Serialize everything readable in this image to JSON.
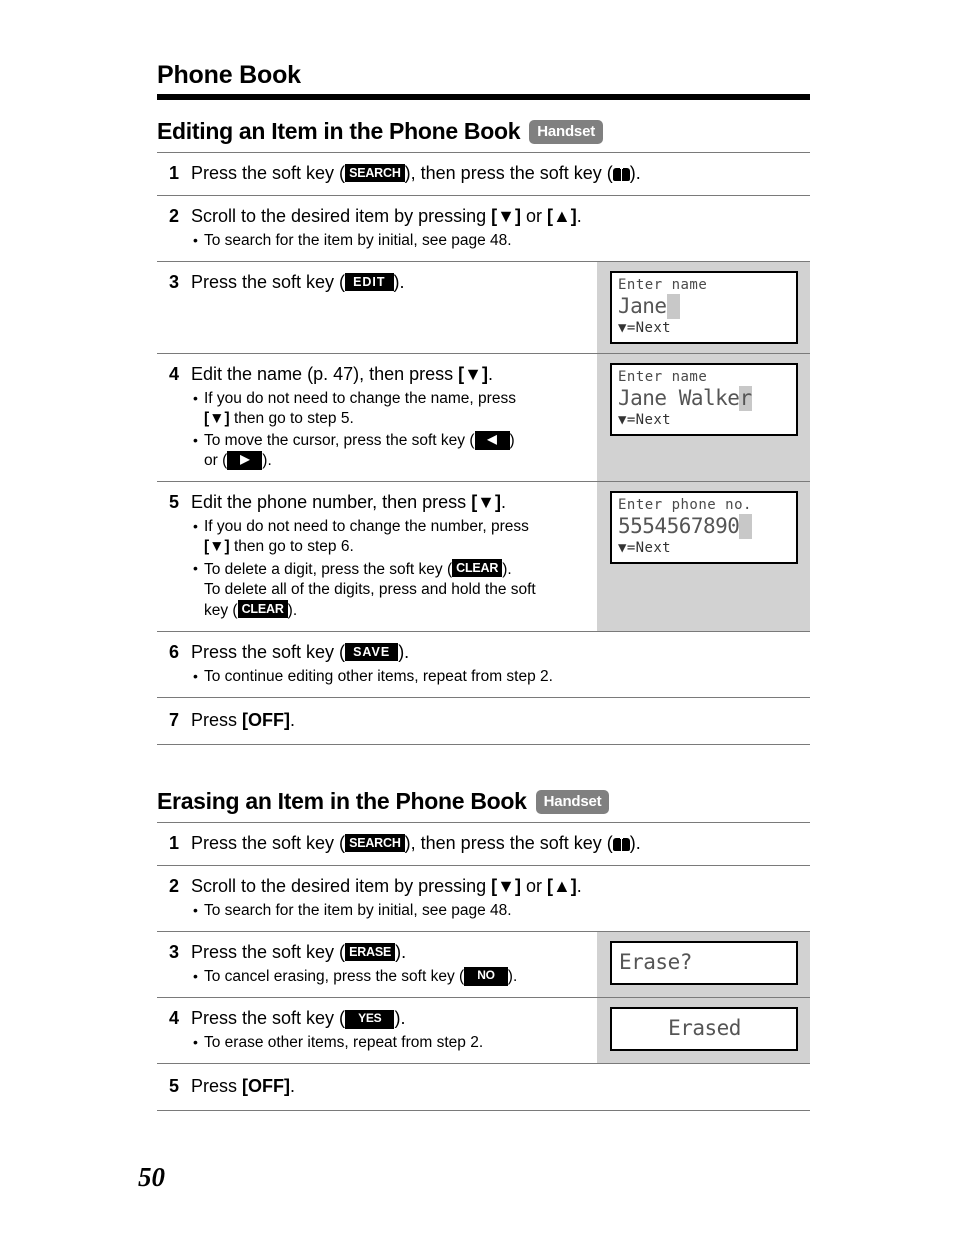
{
  "page": {
    "running_head": "Phone Book",
    "folio": "50"
  },
  "sections": [
    {
      "title": "Editing an Item in the Phone Book",
      "badge": "Handset",
      "steps": [
        {
          "num": "1",
          "text_parts": [
            "Press the soft key (",
            "SEARCH",
            "), then press the soft key (",
            "book-icon",
            ")."
          ],
          "key": "SEARCH",
          "text_a": "Press the soft key (",
          "text_b": "), then press the soft key (",
          "text_c": ").",
          "bullets": []
        },
        {
          "num": "2",
          "text_a": "Scroll to the desired item by pressing ",
          "key_a": "[▼]",
          "text_b": " or ",
          "key_b": "[▲]",
          "text_c": ".",
          "bullets": [
            "To search for the item by initial, see page 48."
          ]
        },
        {
          "num": "3",
          "text_a": "Press the soft key (",
          "key": "EDIT",
          "text_b": ").",
          "bullets": [],
          "lcd": {
            "title": "Enter name",
            "entry": "Jane",
            "cursor": "block",
            "foot": "▼=Next"
          }
        },
        {
          "num": "4",
          "text_a": "Edit the name (p. 47), then press ",
          "key_a": "[▼]",
          "text_b": ".",
          "bullets": [],
          "bullet_rich": [
            "If you do not need to change the name, press [▼] then go to step 5.",
            "To move the cursor, press the soft key ( ◀ ) or ( ▶ )."
          ],
          "lcd": {
            "title": "Enter name",
            "entry": "Jane Walke",
            "cursor_char": "r",
            "foot": "▼=Next"
          }
        },
        {
          "num": "5",
          "text_a": "Edit the phone number, then press ",
          "key_a": "[▼]",
          "text_b": ".",
          "bullet_rich": [
            "If you do not need to change the number, press [▼] then go to step 6.",
            "To delete a digit, press the soft key ( CLEAR ). To delete all of the digits, press and hold the soft key ( CLEAR )."
          ],
          "lcd": {
            "title": "Enter phone no.",
            "entry": "5554567890",
            "cursor": "block",
            "foot": "▼=Next"
          }
        },
        {
          "num": "6",
          "text_a": "Press the soft key (",
          "key": "SAVE",
          "text_b": ").",
          "bullets": [
            "To continue editing other items, repeat from step 2."
          ]
        },
        {
          "num": "7",
          "text_a": "Press ",
          "key_a": "[OFF]",
          "text_b": ".",
          "bullets": []
        }
      ]
    },
    {
      "title": "Erasing an Item in the Phone Book",
      "badge": "Handset",
      "steps": [
        {
          "num": "1",
          "text_a": "Press the soft key (",
          "key": "SEARCH",
          "text_b": "), then press the soft key (",
          "text_c": ").",
          "bullets": []
        },
        {
          "num": "2",
          "text_a": "Scroll to the desired item by pressing ",
          "key_a": "[▼]",
          "text_b": " or ",
          "key_b": "[▲]",
          "text_c": ".",
          "bullets": [
            "To search for the item by initial, see page 48."
          ]
        },
        {
          "num": "3",
          "text_a": "Press the soft key (",
          "key": "ERASE",
          "text_b": ").",
          "bullet_rich": [
            "To cancel erasing, press the soft key ( NO )."
          ],
          "lcd": {
            "entry": "Erase?",
            "align": "left"
          }
        },
        {
          "num": "4",
          "text_a": "Press the soft key (",
          "key": "YES",
          "text_b": ").",
          "bullets": [
            "To erase other items, repeat from step 2."
          ],
          "lcd": {
            "entry": "Erased",
            "align": "center"
          }
        },
        {
          "num": "5",
          "text_a": "Press ",
          "key_a": "[OFF]",
          "text_b": ".",
          "bullets": []
        }
      ]
    }
  ],
  "labels": {
    "key_search": "SEARCH",
    "key_edit": "EDIT",
    "key_clear": "CLEAR",
    "key_save": "SAVE",
    "key_erase": "ERASE",
    "key_yes": "YES",
    "key_no": "NO",
    "key_off": "[OFF]",
    "key_down": "[▼]",
    "key_up": "[▲]",
    "arrow_left": "◀",
    "arrow_right": "▶"
  },
  "colors": {
    "lcd_panel_bg": "#d2d2d2",
    "lcd_screen_bg": "#ffffff",
    "badge_bg": "#808080",
    "rule": "#7a7a7a",
    "cursor": "#c8c8c8"
  }
}
